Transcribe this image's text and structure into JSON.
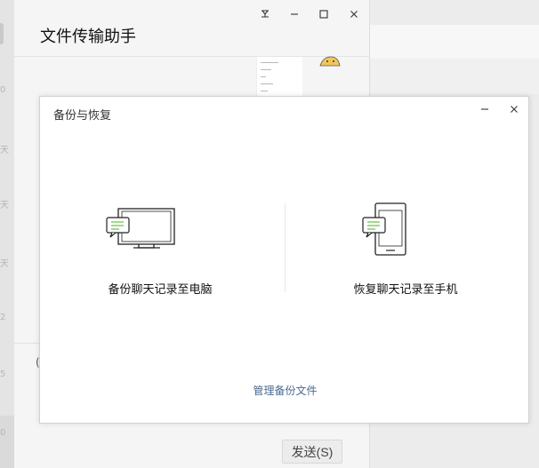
{
  "chat": {
    "title": "文件传输助手",
    "send_label": "发送(S)",
    "paren_glyph": "("
  },
  "sidebar": {
    "glyphs": [
      "0",
      "天",
      "天",
      "天",
      "2",
      "5",
      "0"
    ]
  },
  "dialog": {
    "title": "备份与恢复",
    "backup_label": "备份聊天记录至电脑",
    "restore_label": "恢复聊天记录至手机",
    "manage_link": "管理备份文件"
  },
  "colors": {
    "link": "#4a6a8d",
    "chat_bubble": "#6cc24a"
  }
}
